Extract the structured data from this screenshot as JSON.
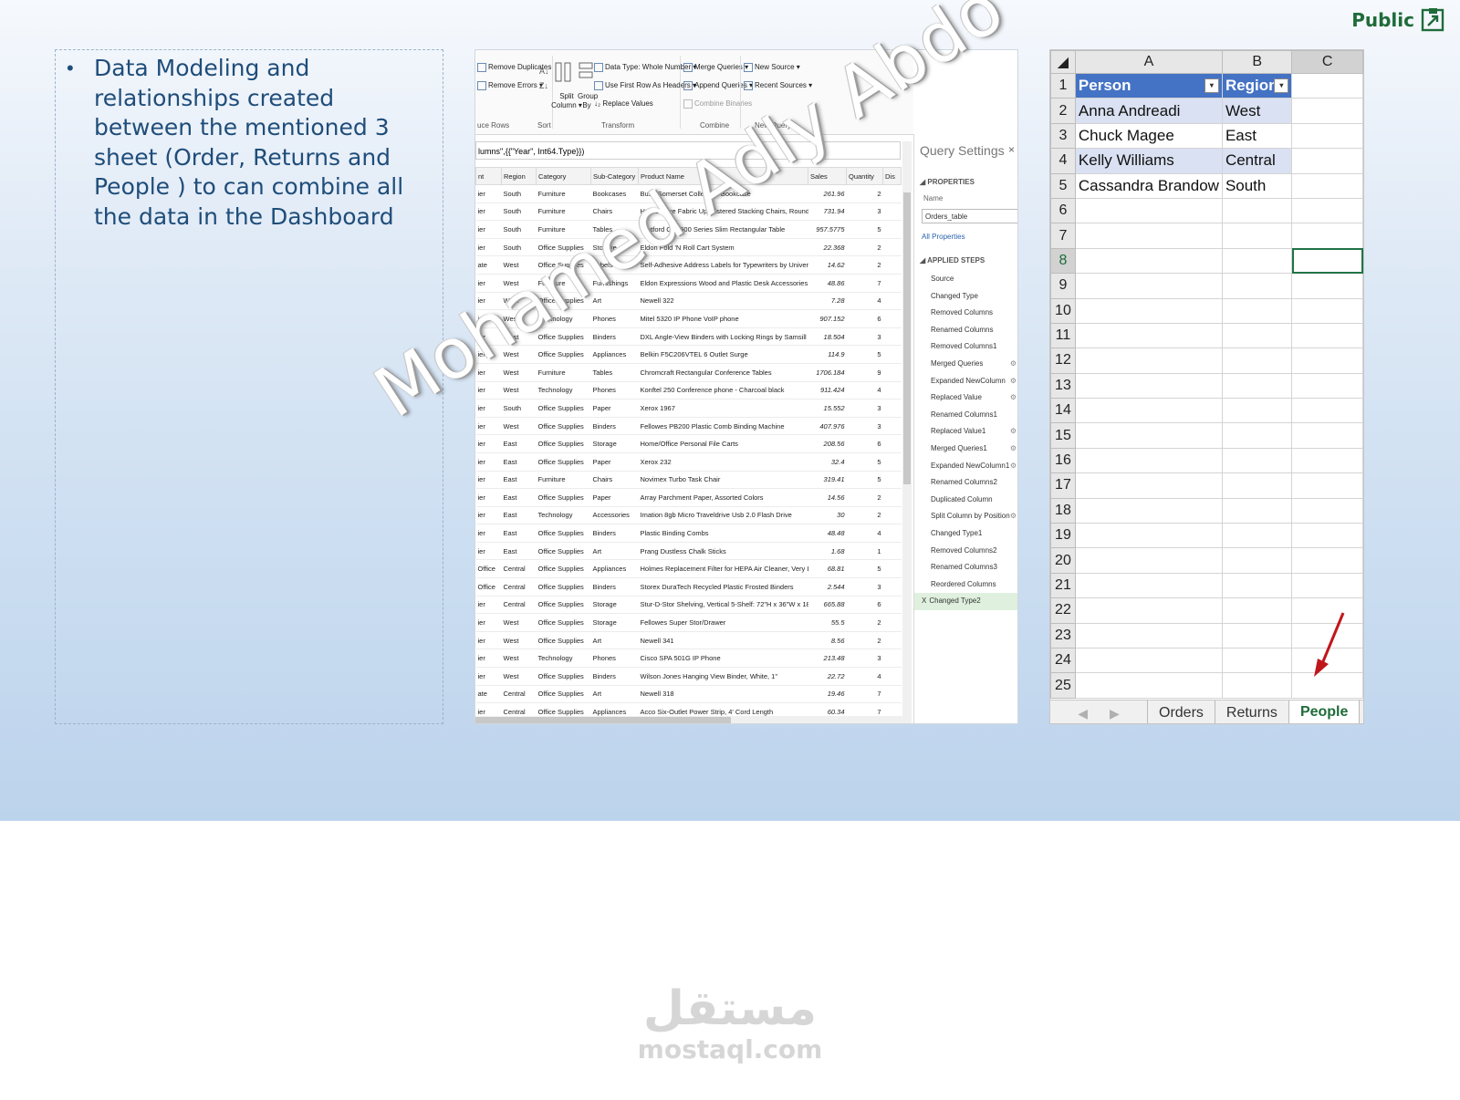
{
  "public_label": "Public",
  "bullet_text": "Data Modeling and relationships created between the mentioned 3 sheet (Order, Returns and People ) to can combine all the data in the Dashboard",
  "watermark_text": "Mohamed Adly Abdo",
  "footer": {
    "arabic": "مستقل",
    "domain": "mostaql.com"
  },
  "power_query": {
    "ribbon": {
      "remove_duplicates": "Remove Duplicates",
      "remove_errors": "Remove Errors ▾",
      "reduce_rows": "uce Rows",
      "sort": "Sort",
      "split_column": "Split Column ▾",
      "group_by": "Group By",
      "data_type": "Data Type: Whole Number ▾",
      "first_row_headers": "Use First Row As Headers ▾",
      "replace_values": "↓₂ Replace Values",
      "transform": "Transform",
      "merge_queries": "Merge Queries ▾",
      "append_queries": "Append Queries ▾",
      "combine_binaries": "Combine Binaries",
      "combine": "Combine",
      "new_source": "New Source ▾",
      "recent_sources": "Recent Sources ▾",
      "new_query": "New Query"
    },
    "formula": "lumns\",{{\"Year\", Int64.Type}})",
    "columns": [
      "nt",
      "Region",
      "Category",
      "Sub-Category",
      "Product Name",
      "Sales",
      "Quantity",
      "Dis"
    ],
    "rows": [
      [
        "ier",
        "South",
        "Furniture",
        "Bookcases",
        "Bush Somerset Collection Bookcase",
        "261.96",
        "2"
      ],
      [
        "ier",
        "South",
        "Furniture",
        "Chairs",
        "Hon Deluxe Fabric Upholstered Stacking Chairs, Rounded Back",
        "731.94",
        "3"
      ],
      [
        "ier",
        "South",
        "Furniture",
        "Tables",
        "Bretford CR4500 Series Slim Rectangular Table",
        "957.5775",
        "5"
      ],
      [
        "ier",
        "South",
        "Office Supplies",
        "Storage",
        "Eldon Fold 'N Roll Cart System",
        "22.368",
        "2"
      ],
      [
        "ate",
        "West",
        "Office Supplies",
        "Labels",
        "Self-Adhesive Address Labels for Typewriters by Universal",
        "14.62",
        "2"
      ],
      [
        "ier",
        "West",
        "Furniture",
        "Furnishings",
        "Eldon Expressions Wood and Plastic Desk Accessories, Cherry Wood",
        "48.86",
        "7"
      ],
      [
        "ier",
        "West",
        "Office Supplies",
        "Art",
        "Newell 322",
        "7.28",
        "4"
      ],
      [
        "ier",
        "West",
        "Technology",
        "Phones",
        "Mitel 5320 IP Phone VoIP phone",
        "907.152",
        "6"
      ],
      [
        "ier",
        "West",
        "Office Supplies",
        "Binders",
        "DXL Angle-View Binders with Locking Rings by Samsill",
        "18.504",
        "3"
      ],
      [
        "ier",
        "West",
        "Office Supplies",
        "Appliances",
        "Belkin F5C206VTEL 6 Outlet Surge",
        "114.9",
        "5"
      ],
      [
        "ier",
        "West",
        "Furniture",
        "Tables",
        "Chromcraft Rectangular Conference Tables",
        "1706.184",
        "9"
      ],
      [
        "ier",
        "West",
        "Technology",
        "Phones",
        "Konftel 250 Conference phone - Charcoal black",
        "911.424",
        "4"
      ],
      [
        "ier",
        "South",
        "Office Supplies",
        "Paper",
        "Xerox 1967",
        "15.552",
        "3"
      ],
      [
        "ier",
        "West",
        "Office Supplies",
        "Binders",
        "Fellowes PB200 Plastic Comb Binding Machine",
        "407.976",
        "3"
      ],
      [
        "ier",
        "East",
        "Office Supplies",
        "Storage",
        "Home/Office Personal File Carts",
        "208.56",
        "6"
      ],
      [
        "ier",
        "East",
        "Office Supplies",
        "Paper",
        "Xerox 232",
        "32.4",
        "5"
      ],
      [
        "ier",
        "East",
        "Furniture",
        "Chairs",
        "Novimex Turbo Task Chair",
        "319.41",
        "5"
      ],
      [
        "ier",
        "East",
        "Office Supplies",
        "Paper",
        "Array Parchment Paper, Assorted Colors",
        "14.56",
        "2"
      ],
      [
        "ier",
        "East",
        "Technology",
        "Accessories",
        "Imation 8gb Micro Traveldrive Usb 2.0 Flash Drive",
        "30",
        "2"
      ],
      [
        "ier",
        "East",
        "Office Supplies",
        "Binders",
        "Plastic Binding Combs",
        "48.48",
        "4"
      ],
      [
        "ier",
        "East",
        "Office Supplies",
        "Art",
        "Prang Dustless Chalk Sticks",
        "1.68",
        "1"
      ],
      [
        "Office",
        "Central",
        "Office Supplies",
        "Appliances",
        "Holmes Replacement Filter for HEPA Air Cleaner, Very Large Room, HEPA Filter",
        "68.81",
        "5"
      ],
      [
        "Office",
        "Central",
        "Office Supplies",
        "Binders",
        "Storex DuraTech Recycled Plastic Frosted Binders",
        "2.544",
        "3"
      ],
      [
        "ier",
        "Central",
        "Office Supplies",
        "Storage",
        "Stur-D-Stor Shelving, Vertical 5-Shelf: 72\"H x 36\"W x 18 1/2\"D",
        "665.88",
        "6"
      ],
      [
        "ier",
        "West",
        "Office Supplies",
        "Storage",
        "Fellowes Super Stor/Drawer",
        "55.5",
        "2"
      ],
      [
        "ier",
        "West",
        "Office Supplies",
        "Art",
        "Newell 341",
        "8.56",
        "2"
      ],
      [
        "ier",
        "West",
        "Technology",
        "Phones",
        "Cisco SPA 501G IP Phone",
        "213.48",
        "3"
      ],
      [
        "ier",
        "West",
        "Office Supplies",
        "Binders",
        "Wilson Jones Hanging View Binder, White, 1\"",
        "22.72",
        "4"
      ],
      [
        "ate",
        "Central",
        "Office Supplies",
        "Art",
        "Newell 318",
        "19.46",
        "7"
      ],
      [
        "ier",
        "Central",
        "Office Supplies",
        "Appliances",
        "Acco Six-Outlet Power Strip, 4' Cord Length",
        "60.34",
        "7"
      ]
    ],
    "query_settings": {
      "title": "Query Settings",
      "close": "×",
      "properties": "◢ PROPERTIES",
      "name_label": "Name",
      "name_value": "Orders_table",
      "all_properties": "All Properties",
      "applied_steps": "◢ APPLIED STEPS",
      "steps": [
        "Source",
        "Changed Type",
        "Removed Columns",
        "Renamed Columns",
        "Removed Columns1",
        "Merged Queries",
        "Expanded NewColumn",
        "Replaced Value",
        "Renamed Columns1",
        "Replaced Value1",
        "Merged Queries1",
        "Expanded NewColumn1",
        "Renamed Columns2",
        "Duplicated Column",
        "Split Column by Position",
        "Changed Type1",
        "Removed Columns2",
        "Renamed Columns3",
        "Reordered Columns",
        "Changed Type2"
      ],
      "active_step_prefix": "X"
    }
  },
  "excel": {
    "col_headers": [
      "A",
      "B",
      "C"
    ],
    "table_header": [
      "Person",
      "Region"
    ],
    "data": [
      [
        "Anna Andreadi",
        "West"
      ],
      [
        "Chuck Magee",
        "East"
      ],
      [
        "Kelly Williams",
        "Central"
      ],
      [
        "Cassandra Brandow",
        "South"
      ]
    ],
    "row_numbers": [
      "1",
      "2",
      "3",
      "4",
      "5",
      "6",
      "7",
      "8",
      "9",
      "10",
      "11",
      "12",
      "13",
      "14",
      "15",
      "16",
      "17",
      "18",
      "19",
      "20",
      "21",
      "22",
      "23",
      "24",
      "25"
    ],
    "selected_row": "8",
    "selected_col": "C",
    "tabs": [
      "Orders",
      "Returns",
      "People"
    ],
    "active_tab": "People",
    "nav_prev": "◀",
    "nav_next": "▶",
    "accent": "#217346",
    "table_header_color": "#4472c4"
  }
}
